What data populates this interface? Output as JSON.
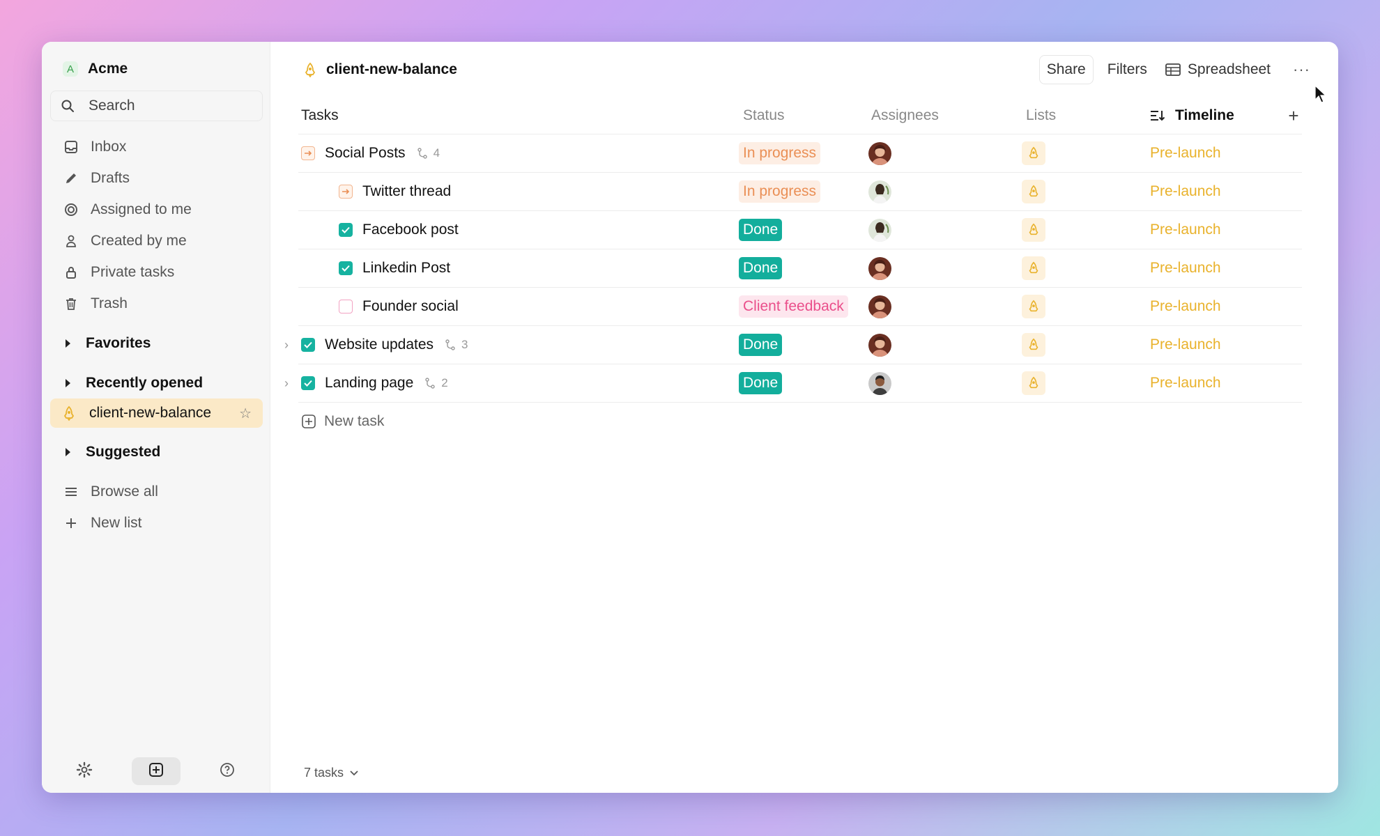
{
  "workspace": {
    "badge": "A",
    "name": "Acme"
  },
  "search": {
    "label": "Search"
  },
  "nav": {
    "inbox": "Inbox",
    "drafts": "Drafts",
    "assigned": "Assigned to me",
    "created": "Created by me",
    "private": "Private tasks",
    "trash": "Trash"
  },
  "sections": {
    "favorites": "Favorites",
    "recent": "Recently opened",
    "suggested": "Suggested"
  },
  "recent_item": {
    "label": "client-new-balance",
    "icon": "rocket-icon"
  },
  "bottom_nav": {
    "browse": "Browse all",
    "new_list": "New list"
  },
  "header": {
    "title": "client-new-balance",
    "share": "Share",
    "filters": "Filters",
    "view": "Spreadsheet",
    "more": "···"
  },
  "columns": {
    "tasks": "Tasks",
    "status": "Status",
    "assignees": "Assignees",
    "lists": "Lists",
    "timeline": "Timeline",
    "add": "+"
  },
  "rows": [
    {
      "name": "Social Posts",
      "subtasks": "4",
      "state": "in-progress",
      "status": "In progress",
      "timeline": "Pre-launch"
    },
    {
      "name": "Twitter thread",
      "state": "in-progress",
      "status": "In progress",
      "timeline": "Pre-launch"
    },
    {
      "name": "Facebook post",
      "state": "done",
      "status": "Done",
      "timeline": "Pre-launch"
    },
    {
      "name": "Linkedin Post",
      "state": "done",
      "status": "Done",
      "timeline": "Pre-launch"
    },
    {
      "name": "Founder social",
      "state": "todo",
      "status": "Client feedback",
      "timeline": "Pre-launch"
    },
    {
      "name": "Website updates",
      "subtasks": "3",
      "state": "done",
      "status": "Done",
      "timeline": "Pre-launch"
    },
    {
      "name": "Landing page",
      "subtasks": "2",
      "state": "done",
      "status": "Done",
      "timeline": "Pre-launch"
    }
  ],
  "new_task": "New task",
  "footer": {
    "count": "7 tasks"
  },
  "colors": {
    "accent": "#13ae9c",
    "in_progress": "#ea8f55",
    "feedback": "#ea4f8b",
    "timeline": "#e9b22c",
    "active_bg": "#fbe9c7"
  }
}
